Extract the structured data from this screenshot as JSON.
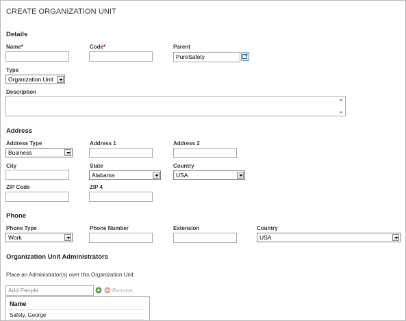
{
  "page_title": "CREATE ORGANIZATION UNIT",
  "details": {
    "heading": "Details",
    "name_label": "Name",
    "required_mark": "*",
    "code_label": "Code",
    "parent_label": "Parent",
    "parent_value": "PureSafety",
    "type_label": "Type",
    "type_value": "Organization Unit",
    "description_label": "Description"
  },
  "address": {
    "heading": "Address",
    "type_label": "Address Type",
    "type_value": "Business",
    "address1_label": "Address 1",
    "address2_label": "Address 2",
    "city_label": "City",
    "state_label": "State",
    "state_value": "Alabama",
    "country_label": "Country",
    "country_value": "USA",
    "zip_label": "ZIP Code",
    "zip4_label": "ZIP 4"
  },
  "phone": {
    "heading": "Phone",
    "type_label": "Phone Type",
    "type_value": "Work",
    "number_label": "Phone Number",
    "extension_label": "Extension",
    "country_label": "Country",
    "country_value": "USA"
  },
  "admins": {
    "heading": "Organization Unit Administrators",
    "hint": "Place an Administrator(s) over this Organization Unit.",
    "add_placeholder": "Add People",
    "remove_label": "Remove",
    "grid_header": "Name",
    "rows": [
      "Safety, George"
    ]
  },
  "icons": {
    "parent_picker": "org-picker-icon",
    "add": "add-circle-icon",
    "remove": "remove-circle-icon"
  }
}
